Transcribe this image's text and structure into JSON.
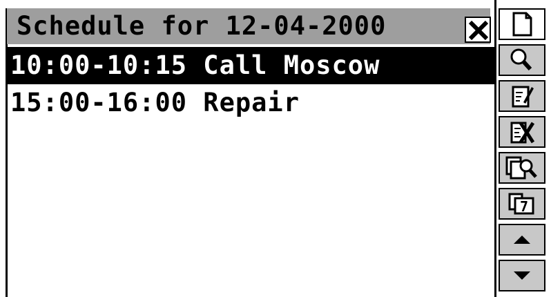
{
  "window": {
    "title": "Schedule for 12-04-2000"
  },
  "schedule": {
    "entries": [
      {
        "text": "10:00-10:15 Call Moscow",
        "selected": true
      },
      {
        "text": "15:00-16:00 Repair",
        "selected": false
      }
    ]
  },
  "toolbar": {
    "buttons": [
      {
        "icon": "new-document-icon"
      },
      {
        "icon": "search-icon"
      },
      {
        "icon": "edit-icon"
      },
      {
        "icon": "delete-icon"
      },
      {
        "icon": "find-in-calendar-icon"
      },
      {
        "icon": "calendar-icon",
        "text": "7"
      },
      {
        "icon": "scroll-up-icon"
      },
      {
        "icon": "scroll-down-icon"
      }
    ]
  },
  "colors": {
    "title_bar": "#9e9e9e",
    "button_face": "#c8c8c8",
    "selection": "#000000"
  }
}
